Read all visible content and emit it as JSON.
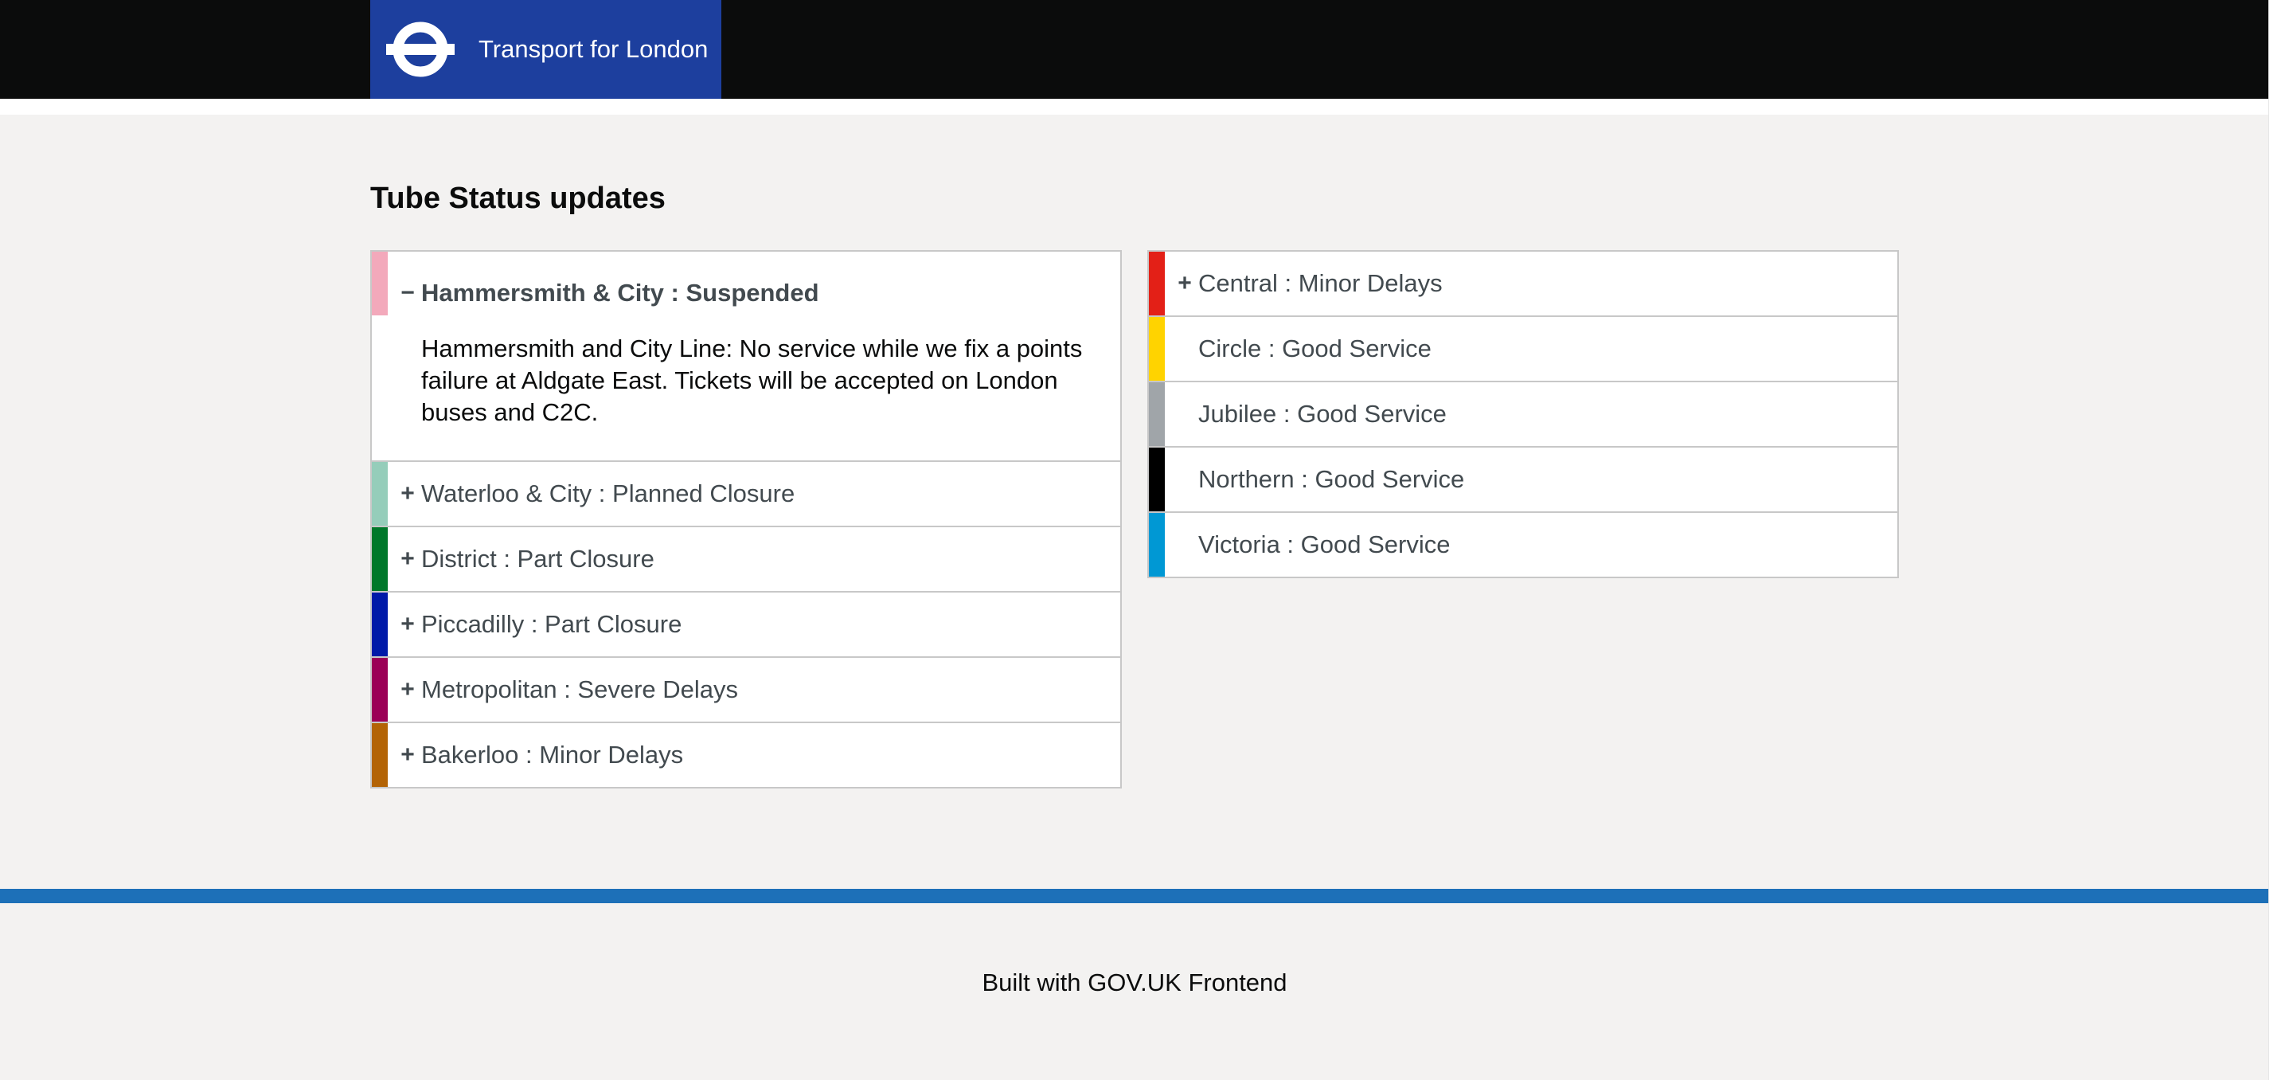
{
  "header": {
    "brand_text": "Transport for London",
    "logo_icon": "tfl-roundel-icon"
  },
  "main": {
    "title": "Tube Status updates"
  },
  "lines_left": [
    {
      "name": "Hammersmith & City : Suspended",
      "color": "#f3a9bb",
      "expanded": true,
      "toggle": "−",
      "description": "Hammersmith and City Line: No service while we fix a points failure at Aldgate East. Tickets will be accepted on London buses and C2C."
    },
    {
      "name": "Waterloo & City : Planned Closure",
      "color": "#95cdba",
      "expanded": false,
      "toggle": "+"
    },
    {
      "name": "District : Part Closure",
      "color": "#00782a",
      "expanded": false,
      "toggle": "+"
    },
    {
      "name": "Piccadilly : Part Closure",
      "color": "#0019a8",
      "expanded": false,
      "toggle": "+"
    },
    {
      "name": "Metropolitan : Severe Delays",
      "color": "#9b0056",
      "expanded": false,
      "toggle": "+"
    },
    {
      "name": "Bakerloo : Minor Delays",
      "color": "#b36305",
      "expanded": false,
      "toggle": "+"
    }
  ],
  "lines_right": [
    {
      "name": "Central : Minor Delays",
      "color": "#e32017",
      "expanded": false,
      "toggle": "+"
    },
    {
      "name": "Circle : Good Service",
      "color": "#ffd300",
      "expanded": false,
      "toggle": ""
    },
    {
      "name": "Jubilee : Good Service",
      "color": "#a0a5a9",
      "expanded": false,
      "toggle": ""
    },
    {
      "name": "Northern : Good Service",
      "color": "#000000",
      "expanded": false,
      "toggle": ""
    },
    {
      "name": "Victoria : Good Service",
      "color": "#0098d4",
      "expanded": false,
      "toggle": ""
    }
  ],
  "footer": {
    "text": "Built with GOV.UK Frontend",
    "accent_color": "#1d70b8"
  }
}
